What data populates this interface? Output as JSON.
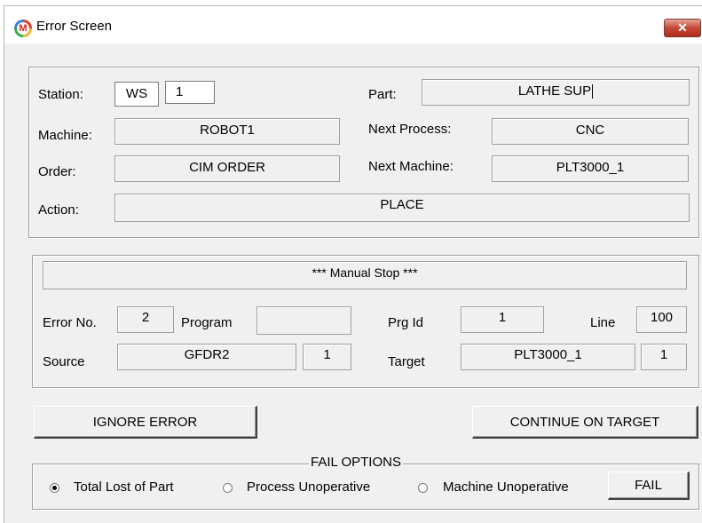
{
  "window": {
    "title": "Error Screen",
    "close_label": "✕",
    "icon_letter": "M"
  },
  "info": {
    "station_label": "Station:",
    "station_prefix": "WS",
    "station_no": "1",
    "part_label": "Part:",
    "part_value": "LATHE SUP",
    "machine_label": "Machine:",
    "machine_value": "ROBOT1",
    "next_process_label": "Next Process:",
    "next_process_value": "CNC",
    "order_label": "Order:",
    "order_value": "CIM ORDER",
    "next_machine_label": "Next Machine:",
    "next_machine_value": "PLT3000_1",
    "action_label": "Action:",
    "action_value": "PLACE"
  },
  "error": {
    "message": "*** Manual Stop ***",
    "error_no_label": "Error No.",
    "error_no_value": "2",
    "program_label": "Program",
    "program_value": "",
    "prg_id_label": "Prg Id",
    "prg_id_value": "1",
    "line_label": "Line",
    "line_value": "100",
    "source_label": "Source",
    "source_value": "GFDR2",
    "source_no": "1",
    "target_label": "Target",
    "target_value": "PLT3000_1",
    "target_no": "1"
  },
  "buttons": {
    "ignore": "IGNORE ERROR",
    "continue": "CONTINUE ON TARGET",
    "fail": "FAIL"
  },
  "fail_options": {
    "title": "FAIL OPTIONS",
    "options": [
      "Total Lost of Part",
      "Process Unoperative",
      "Machine Unoperative"
    ],
    "selected": "Total Lost of Part"
  }
}
